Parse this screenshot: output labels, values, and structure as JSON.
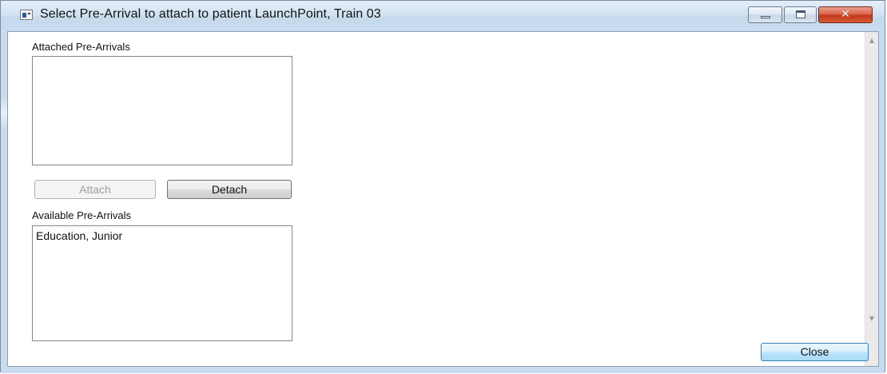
{
  "window": {
    "title": "Select Pre-Arrival to attach to patient LaunchPoint, Train 03",
    "icon": "application-icon",
    "controls": {
      "minimize_icon": "minimize-icon",
      "maximize_icon": "maximize-icon",
      "close_glyph": "✕"
    }
  },
  "attached": {
    "label": "Attached Pre-Arrivals",
    "items": []
  },
  "buttons": {
    "attach_label": "Attach",
    "detach_label": "Detach",
    "close_label": "Close"
  },
  "available": {
    "label": "Available Pre-Arrivals",
    "items": [
      "Education, Junior"
    ]
  },
  "scrollbar": {
    "up_arrow": "▲",
    "down_arrow": "▼"
  },
  "colors": {
    "frame": "#c9dcef",
    "close_button": "#c0381c",
    "default_button_border": "#3c7fb1"
  }
}
